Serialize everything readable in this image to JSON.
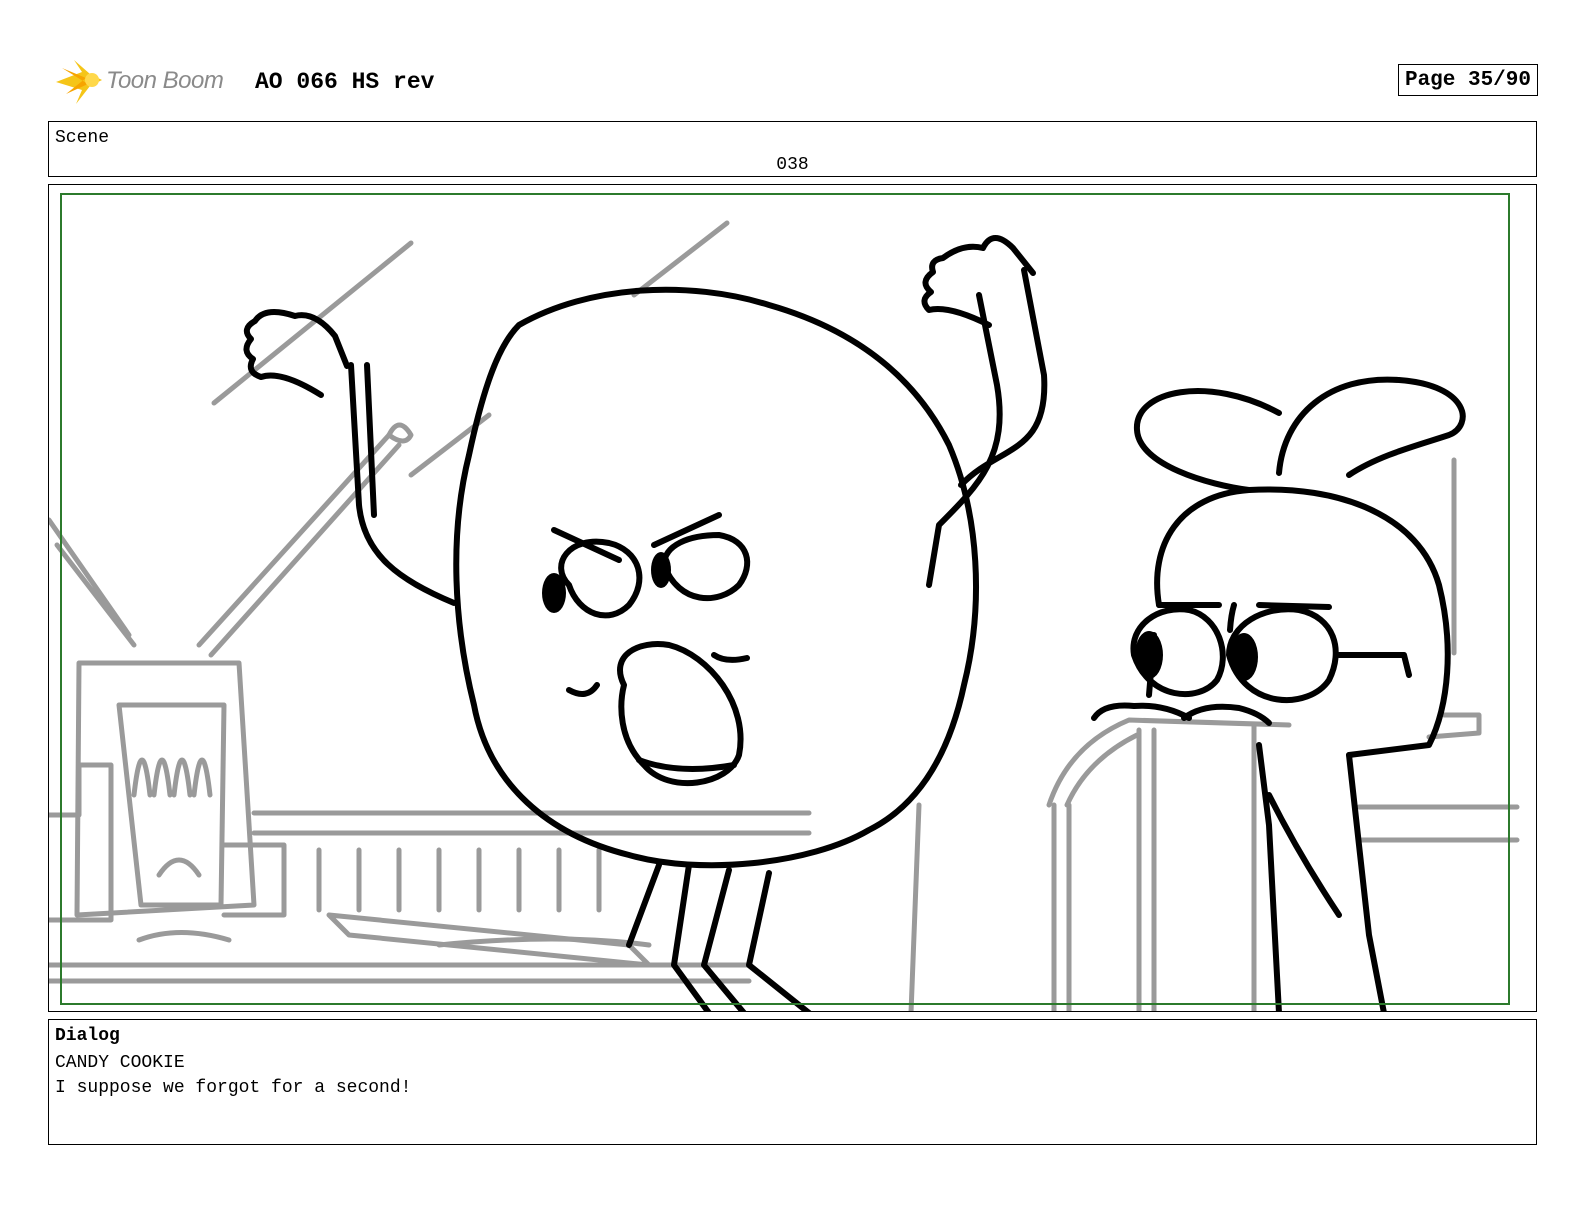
{
  "header": {
    "logo_text": "Toon Boom",
    "title": "AO 066 HS rev",
    "page": "Page 35/90"
  },
  "scene": {
    "label": "Scene",
    "number": "038"
  },
  "panel": {
    "safe_frame_color": "#2c7a2c"
  },
  "dialog": {
    "label": "Dialog",
    "character": "CANDY COOKIE",
    "line": "I suppose we forgot for a second!"
  }
}
